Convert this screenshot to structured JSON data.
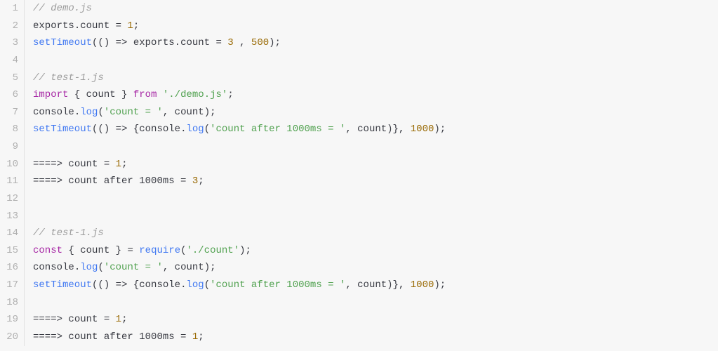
{
  "code": {
    "lines": [
      {
        "num": 1,
        "tokens": [
          {
            "cls": "tk-comment",
            "text": "// demo.js"
          }
        ]
      },
      {
        "num": 2,
        "tokens": [
          {
            "cls": "tk-plain",
            "text": "exports"
          },
          {
            "cls": "tk-punct",
            "text": "."
          },
          {
            "cls": "tk-plain",
            "text": "count"
          },
          {
            "cls": "tk-op",
            "text": " = "
          },
          {
            "cls": "tk-number",
            "text": "1"
          },
          {
            "cls": "tk-punct",
            "text": ";"
          }
        ]
      },
      {
        "num": 3,
        "tokens": [
          {
            "cls": "tk-call",
            "text": "setTimeout"
          },
          {
            "cls": "tk-punct",
            "text": "("
          },
          {
            "cls": "tk-punct",
            "text": "()"
          },
          {
            "cls": "tk-op",
            "text": " => "
          },
          {
            "cls": "tk-plain",
            "text": "exports"
          },
          {
            "cls": "tk-punct",
            "text": "."
          },
          {
            "cls": "tk-plain",
            "text": "count"
          },
          {
            "cls": "tk-op",
            "text": " = "
          },
          {
            "cls": "tk-number",
            "text": "3"
          },
          {
            "cls": "tk-plain",
            "text": " "
          },
          {
            "cls": "tk-punct",
            "text": ", "
          },
          {
            "cls": "tk-number",
            "text": "500"
          },
          {
            "cls": "tk-punct",
            "text": ");"
          }
        ]
      },
      {
        "num": 4,
        "tokens": [
          {
            "cls": "tk-plain",
            "text": ""
          }
        ]
      },
      {
        "num": 5,
        "tokens": [
          {
            "cls": "tk-comment",
            "text": "// test-1.js"
          }
        ]
      },
      {
        "num": 6,
        "tokens": [
          {
            "cls": "tk-keyword",
            "text": "import"
          },
          {
            "cls": "tk-plain",
            "text": " "
          },
          {
            "cls": "tk-punct",
            "text": "{ "
          },
          {
            "cls": "tk-plain",
            "text": "count"
          },
          {
            "cls": "tk-punct",
            "text": " }"
          },
          {
            "cls": "tk-plain",
            "text": " "
          },
          {
            "cls": "tk-keyword",
            "text": "from"
          },
          {
            "cls": "tk-plain",
            "text": " "
          },
          {
            "cls": "tk-string",
            "text": "'./demo.js'"
          },
          {
            "cls": "tk-punct",
            "text": ";"
          }
        ]
      },
      {
        "num": 7,
        "tokens": [
          {
            "cls": "tk-plain",
            "text": "console"
          },
          {
            "cls": "tk-punct",
            "text": "."
          },
          {
            "cls": "tk-call",
            "text": "log"
          },
          {
            "cls": "tk-punct",
            "text": "("
          },
          {
            "cls": "tk-string",
            "text": "'count = '"
          },
          {
            "cls": "tk-punct",
            "text": ", "
          },
          {
            "cls": "tk-plain",
            "text": "count"
          },
          {
            "cls": "tk-punct",
            "text": ");"
          }
        ]
      },
      {
        "num": 8,
        "tokens": [
          {
            "cls": "tk-call",
            "text": "setTimeout"
          },
          {
            "cls": "tk-punct",
            "text": "("
          },
          {
            "cls": "tk-punct",
            "text": "()"
          },
          {
            "cls": "tk-op",
            "text": " => "
          },
          {
            "cls": "tk-punct",
            "text": "{"
          },
          {
            "cls": "tk-plain",
            "text": "console"
          },
          {
            "cls": "tk-punct",
            "text": "."
          },
          {
            "cls": "tk-call",
            "text": "log"
          },
          {
            "cls": "tk-punct",
            "text": "("
          },
          {
            "cls": "tk-string",
            "text": "'count after 1000ms = '"
          },
          {
            "cls": "tk-punct",
            "text": ", "
          },
          {
            "cls": "tk-plain",
            "text": "count"
          },
          {
            "cls": "tk-punct",
            "text": ")}"
          },
          {
            "cls": "tk-punct",
            "text": ", "
          },
          {
            "cls": "tk-number",
            "text": "1000"
          },
          {
            "cls": "tk-punct",
            "text": ");"
          }
        ]
      },
      {
        "num": 9,
        "tokens": [
          {
            "cls": "tk-plain",
            "text": ""
          }
        ]
      },
      {
        "num": 10,
        "tokens": [
          {
            "cls": "tk-op",
            "text": "====> "
          },
          {
            "cls": "tk-plain",
            "text": "count"
          },
          {
            "cls": "tk-op",
            "text": " = "
          },
          {
            "cls": "tk-number",
            "text": "1"
          },
          {
            "cls": "tk-punct",
            "text": ";"
          }
        ]
      },
      {
        "num": 11,
        "tokens": [
          {
            "cls": "tk-op",
            "text": "====> "
          },
          {
            "cls": "tk-plain",
            "text": "count after 1000ms"
          },
          {
            "cls": "tk-op",
            "text": " = "
          },
          {
            "cls": "tk-number",
            "text": "3"
          },
          {
            "cls": "tk-punct",
            "text": ";"
          }
        ]
      },
      {
        "num": 12,
        "tokens": [
          {
            "cls": "tk-plain",
            "text": ""
          }
        ]
      },
      {
        "num": 13,
        "tokens": [
          {
            "cls": "tk-plain",
            "text": ""
          }
        ]
      },
      {
        "num": 14,
        "tokens": [
          {
            "cls": "tk-comment",
            "text": "// test-1.js"
          }
        ]
      },
      {
        "num": 15,
        "tokens": [
          {
            "cls": "tk-keyword",
            "text": "const"
          },
          {
            "cls": "tk-plain",
            "text": " "
          },
          {
            "cls": "tk-punct",
            "text": "{ "
          },
          {
            "cls": "tk-plain",
            "text": "count"
          },
          {
            "cls": "tk-punct",
            "text": " }"
          },
          {
            "cls": "tk-op",
            "text": " = "
          },
          {
            "cls": "tk-call",
            "text": "require"
          },
          {
            "cls": "tk-punct",
            "text": "("
          },
          {
            "cls": "tk-string",
            "text": "'./count'"
          },
          {
            "cls": "tk-punct",
            "text": ");"
          }
        ]
      },
      {
        "num": 16,
        "tokens": [
          {
            "cls": "tk-plain",
            "text": "console"
          },
          {
            "cls": "tk-punct",
            "text": "."
          },
          {
            "cls": "tk-call",
            "text": "log"
          },
          {
            "cls": "tk-punct",
            "text": "("
          },
          {
            "cls": "tk-string",
            "text": "'count = '"
          },
          {
            "cls": "tk-punct",
            "text": ", "
          },
          {
            "cls": "tk-plain",
            "text": "count"
          },
          {
            "cls": "tk-punct",
            "text": ");"
          }
        ]
      },
      {
        "num": 17,
        "tokens": [
          {
            "cls": "tk-call",
            "text": "setTimeout"
          },
          {
            "cls": "tk-punct",
            "text": "("
          },
          {
            "cls": "tk-punct",
            "text": "()"
          },
          {
            "cls": "tk-op",
            "text": " => "
          },
          {
            "cls": "tk-punct",
            "text": "{"
          },
          {
            "cls": "tk-plain",
            "text": "console"
          },
          {
            "cls": "tk-punct",
            "text": "."
          },
          {
            "cls": "tk-call",
            "text": "log"
          },
          {
            "cls": "tk-punct",
            "text": "("
          },
          {
            "cls": "tk-string",
            "text": "'count after 1000ms = '"
          },
          {
            "cls": "tk-punct",
            "text": ", "
          },
          {
            "cls": "tk-plain",
            "text": "count"
          },
          {
            "cls": "tk-punct",
            "text": ")}"
          },
          {
            "cls": "tk-punct",
            "text": ", "
          },
          {
            "cls": "tk-number",
            "text": "1000"
          },
          {
            "cls": "tk-punct",
            "text": ");"
          }
        ]
      },
      {
        "num": 18,
        "tokens": [
          {
            "cls": "tk-plain",
            "text": ""
          }
        ]
      },
      {
        "num": 19,
        "tokens": [
          {
            "cls": "tk-op",
            "text": "====> "
          },
          {
            "cls": "tk-plain",
            "text": "count"
          },
          {
            "cls": "tk-op",
            "text": " = "
          },
          {
            "cls": "tk-number",
            "text": "1"
          },
          {
            "cls": "tk-punct",
            "text": ";"
          }
        ]
      },
      {
        "num": 20,
        "tokens": [
          {
            "cls": "tk-op",
            "text": "====> "
          },
          {
            "cls": "tk-plain",
            "text": "count after 1000ms"
          },
          {
            "cls": "tk-op",
            "text": " = "
          },
          {
            "cls": "tk-number",
            "text": "1"
          },
          {
            "cls": "tk-punct",
            "text": ";"
          }
        ]
      }
    ]
  }
}
